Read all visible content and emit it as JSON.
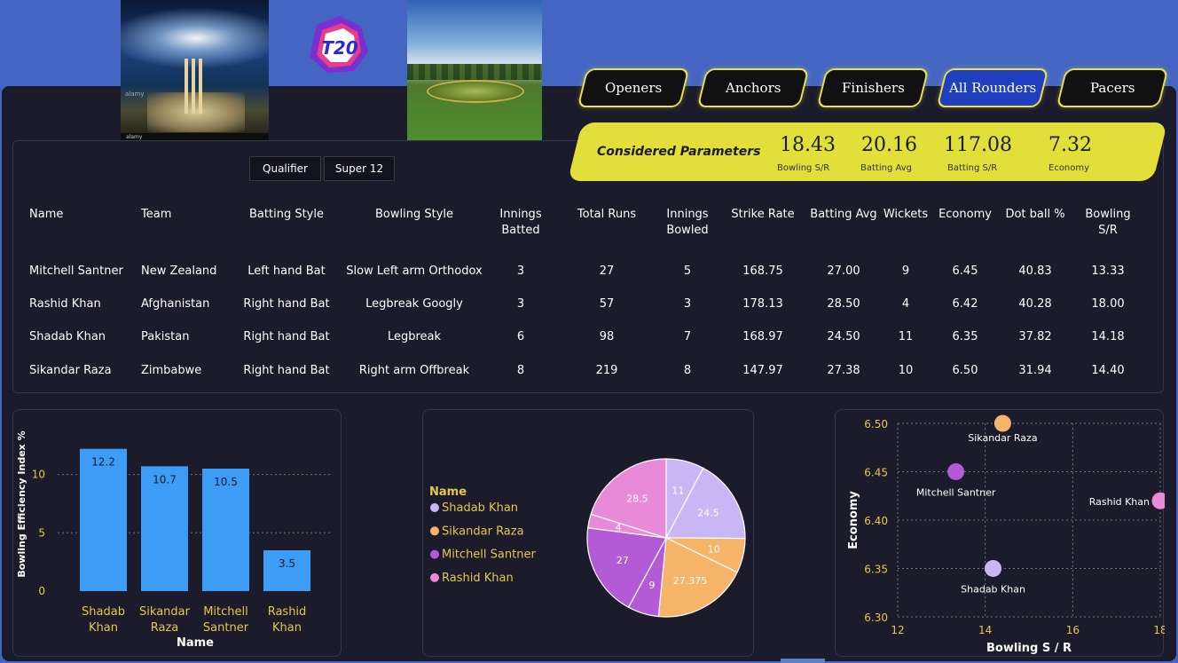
{
  "nav": {
    "buttons": [
      {
        "label": "Openers",
        "active": false
      },
      {
        "label": "Anchors",
        "active": false
      },
      {
        "label": "Finishers",
        "active": false
      },
      {
        "label": "All Rounders",
        "active": true
      },
      {
        "label": "Pacers",
        "active": false
      }
    ]
  },
  "header": {
    "logo_text": "T20",
    "image_watermark": "alamy"
  },
  "params": {
    "title": "Considered Parameters",
    "items": [
      {
        "value": "18.43",
        "label": "Bowling S/R"
      },
      {
        "value": "20.16",
        "label": "Batting Avg"
      },
      {
        "value": "117.08",
        "label": "Batting S/R"
      },
      {
        "value": "7.32",
        "label": "Economy"
      }
    ]
  },
  "filters": {
    "qualifier": "Qualifier",
    "super12": "Super 12"
  },
  "table": {
    "headers": [
      "Name",
      "Team",
      "Batting Style",
      "Bowling Style",
      "Innings\nBatted",
      "Total Runs",
      "Innings\nBowled",
      "Strike Rate",
      "Batting Avg",
      "Wickets",
      "Economy",
      "Dot ball %",
      "Bowling\nS/R"
    ],
    "rows": [
      [
        "Mitchell Santner",
        "New Zealand",
        "Left hand Bat",
        "Slow Left arm Orthodox",
        "3",
        "27",
        "5",
        "168.75",
        "27.00",
        "9",
        "6.45",
        "40.83",
        "13.33"
      ],
      [
        "Rashid Khan",
        "Afghanistan",
        "Right hand Bat",
        "Legbreak Googly",
        "3",
        "57",
        "3",
        "178.13",
        "28.50",
        "4",
        "6.42",
        "40.28",
        "18.00"
      ],
      [
        "Shadab Khan",
        "Pakistan",
        "Right hand Bat",
        "Legbreak",
        "6",
        "98",
        "7",
        "168.97",
        "24.50",
        "11",
        "6.35",
        "37.82",
        "14.18"
      ],
      [
        "Sikandar Raza",
        "Zimbabwe",
        "Right hand Bat",
        "Right arm Offbreak",
        "8",
        "219",
        "8",
        "147.97",
        "27.38",
        "10",
        "6.50",
        "31.94",
        "14.40"
      ]
    ]
  },
  "chart_data": [
    {
      "type": "bar",
      "categories": [
        [
          "Shadab",
          "Khan"
        ],
        [
          "Sikandar",
          "Raza"
        ],
        [
          "Mitchell",
          "Santner"
        ],
        [
          "Rashid",
          "Khan"
        ]
      ],
      "values": [
        12.2,
        10.7,
        10.5,
        3.5
      ],
      "value_labels": [
        "12.2",
        "10.7",
        "10.5",
        "3.5"
      ],
      "xlabel": "Name",
      "ylabel": "Bowling Efficiency Index %",
      "yticks": [
        0,
        5,
        10
      ],
      "ylim": [
        0,
        14
      ],
      "color": "#3d9cf5",
      "grid": true
    },
    {
      "type": "pie",
      "legend_title": "Name",
      "legend": [
        {
          "name": "Shadab Khan",
          "color": "#c8b6f5"
        },
        {
          "name": "Sikandar Raza",
          "color": "#f5b468"
        },
        {
          "name": "Mitchell Santner",
          "color": "#b35ad6"
        },
        {
          "name": "Rashid Khan",
          "color": "#e98ad9"
        }
      ],
      "slices": [
        {
          "value": 11,
          "label": "11",
          "color": "#c8b6f5"
        },
        {
          "value": 24.5,
          "label": "24.5",
          "color": "#c8b6f5"
        },
        {
          "value": 10,
          "label": "10",
          "color": "#f5b468"
        },
        {
          "value": 27.375,
          "label": "27.375",
          "color": "#f5b468"
        },
        {
          "value": 9,
          "label": "9",
          "color": "#b35ad6"
        },
        {
          "value": 27,
          "label": "27",
          "color": "#b35ad6"
        },
        {
          "value": 4,
          "label": "4",
          "color": "#e98ad9"
        },
        {
          "value": 28.5,
          "label": "28.5",
          "color": "#e98ad9"
        }
      ]
    },
    {
      "type": "scatter",
      "xlabel": "Bowling S / R",
      "ylabel": "Economy",
      "xlim": [
        12,
        18
      ],
      "ylim": [
        6.3,
        6.5
      ],
      "xticks": [
        "12",
        "14",
        "16",
        "18"
      ],
      "yticks": [
        "6.30",
        "6.35",
        "6.40",
        "6.45",
        "6.50"
      ],
      "points": [
        {
          "name": "Sikandar Raza",
          "x": 14.4,
          "y": 6.5,
          "color": "#f5b468"
        },
        {
          "name": "Mitchell Santner",
          "x": 13.33,
          "y": 6.45,
          "color": "#b35ad6"
        },
        {
          "name": "Rashid Khan",
          "x": 18.0,
          "y": 6.42,
          "color": "#e98ad9"
        },
        {
          "name": "Shadab Khan",
          "x": 14.18,
          "y": 6.35,
          "color": "#c8b6f5"
        }
      ],
      "grid": true
    }
  ]
}
